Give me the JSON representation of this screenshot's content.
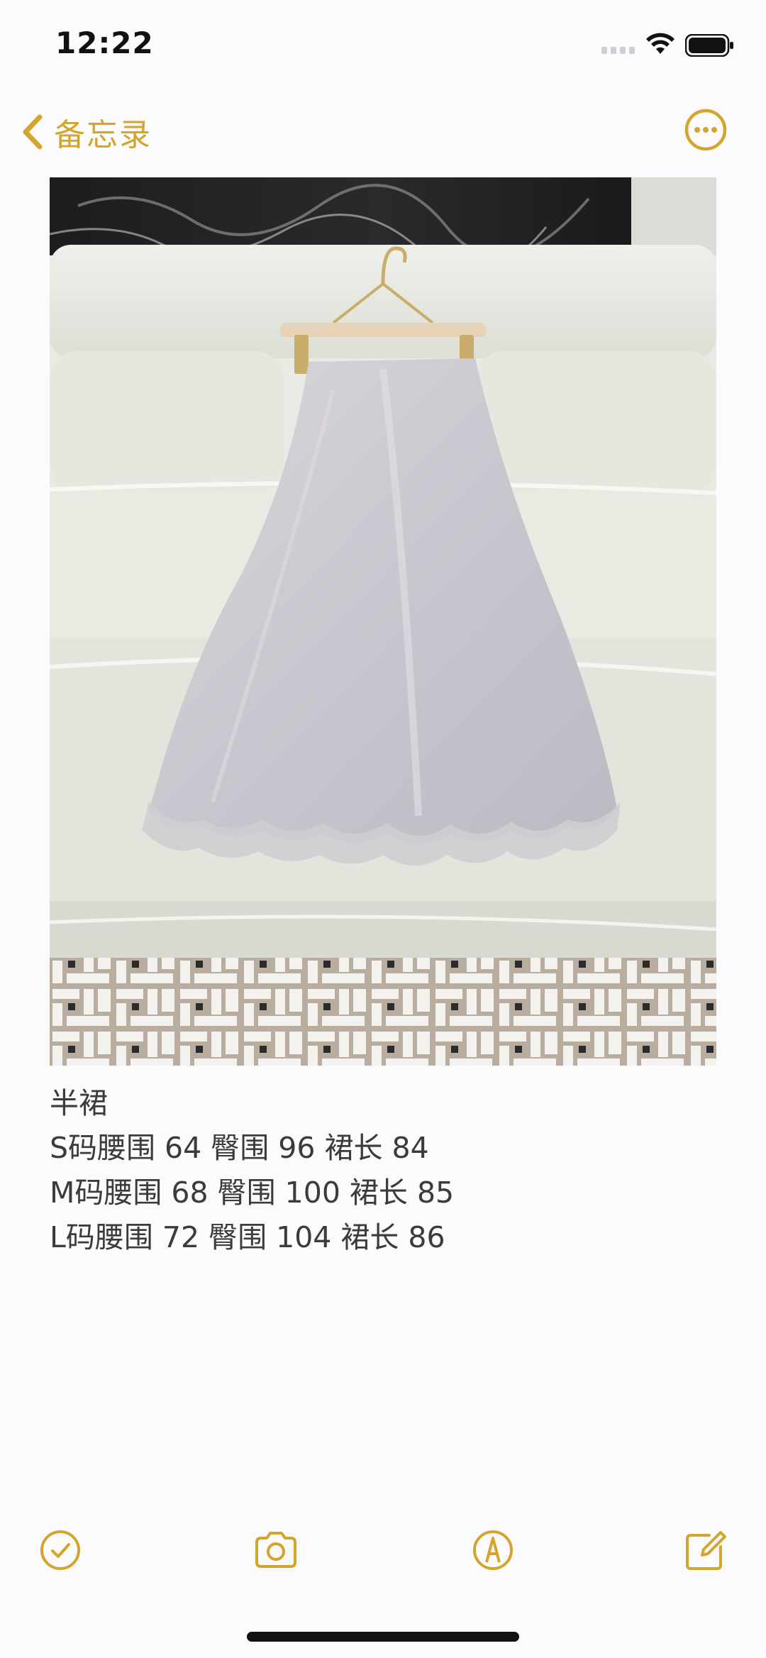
{
  "status_bar": {
    "time": "12:22",
    "icons": [
      "cellular-signal-icon",
      "wifi-icon",
      "battery-icon"
    ]
  },
  "nav": {
    "back_label": "备忘录",
    "back_icon": "chevron-left-icon",
    "more_icon": "ellipsis-circle-icon"
  },
  "note": {
    "image_subject": "silk-slip-skirt-photo",
    "lines": [
      "半裙",
      "S码腰围 64 臀围 96 裙长 84",
      "M码腰围 68 臀围 100 裙长 85",
      "L码腰围 72 臀围 104 裙长 86"
    ]
  },
  "toolbar": {
    "items": [
      {
        "icon": "checklist-icon"
      },
      {
        "icon": "camera-icon"
      },
      {
        "icon": "markup-pen-icon"
      },
      {
        "icon": "compose-icon"
      }
    ]
  },
  "colors": {
    "accent": "#D4A52C",
    "background": "#FBFAFC",
    "text": "#3B3B3D"
  }
}
